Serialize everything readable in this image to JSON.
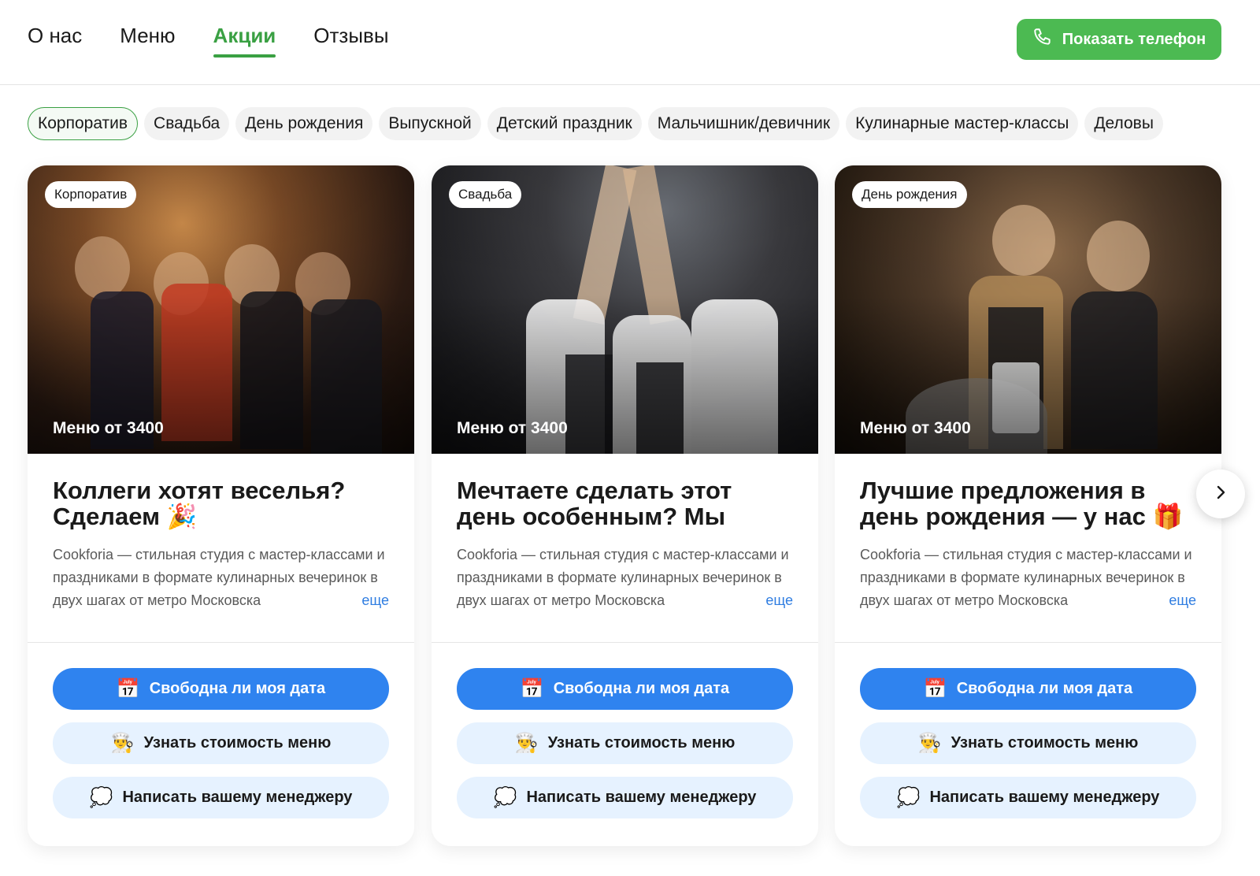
{
  "nav": {
    "items": [
      {
        "label": "О нас",
        "active": false
      },
      {
        "label": "Меню",
        "active": false
      },
      {
        "label": "Акции",
        "active": true
      },
      {
        "label": "Отзывы",
        "active": false
      }
    ],
    "phone_button": "Показать телефон"
  },
  "filters": [
    "Корпоратив",
    "Свадьба",
    "День рождения",
    "Выпускной",
    "Детский праздник",
    "Мальчишник/девичник",
    "Кулинарные мастер-классы",
    "Деловы"
  ],
  "cards": [
    {
      "tag": "Корпоратив",
      "price": "Меню от 3400",
      "title": "Коллеги хотят веселья? Сделаем 🎉",
      "description": "Cookforia — стильная студия с мастер-классами и праздниками в формате кулинарных вечеринок в двух шагах от метро Московска",
      "more": "еще"
    },
    {
      "tag": "Свадьба",
      "price": "Меню от 3400",
      "title": "Мечтаете сделать этот день особенным? Мы поможем...",
      "description": "Cookforia — стильная студия с мастер-классами и праздниками в формате кулинарных вечеринок в двух шагах от метро Московска",
      "more": "еще"
    },
    {
      "tag": "День рождения",
      "price": "Меню от 3400",
      "title": "Лучшие предложения в день рождения — у нас 🎁",
      "description": "Cookforia — стильная студия с мастер-классами и праздниками в формате кулинарных вечеринок в двух шагах от метро Московска",
      "more": "еще"
    }
  ],
  "actions": {
    "check_date": {
      "label": "Свободна ли моя дата",
      "icon": "📅"
    },
    "menu_price": {
      "label": "Узнать стоимость меню",
      "icon": "👨‍🍳"
    },
    "write_manager": {
      "label": "Написать вашему менеджеру",
      "icon": "💭"
    }
  },
  "colors": {
    "accent_green": "#3aa043",
    "phone_button": "#4cba52",
    "primary_blue": "#2f83ef",
    "secondary_blue": "#e6f2ff",
    "link_blue": "#2f7de1"
  }
}
